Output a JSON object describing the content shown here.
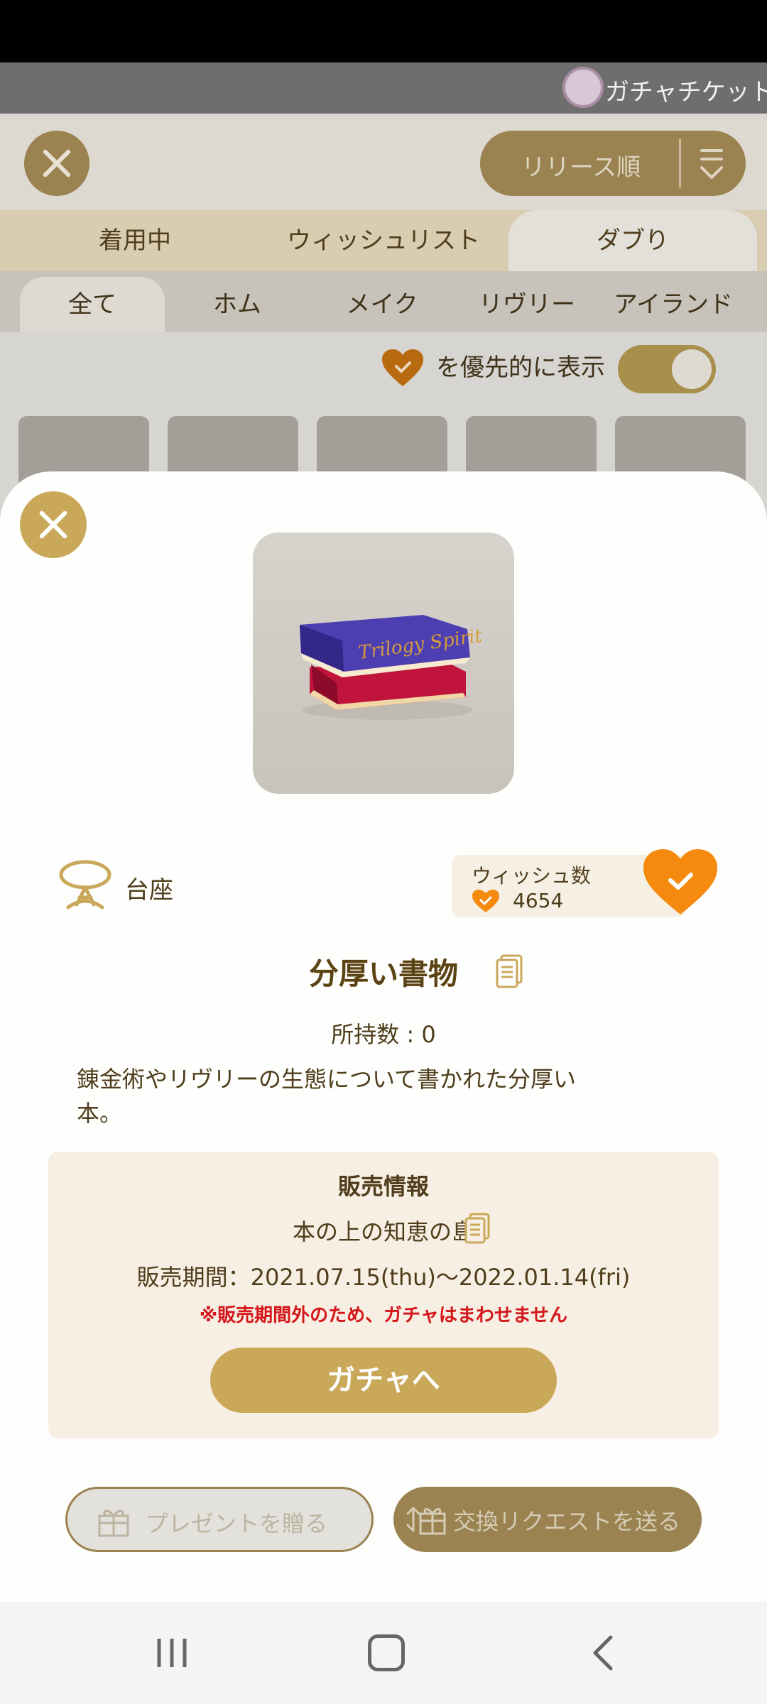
{
  "background": {
    "ticket_label": "ガチャチケット",
    "sort_label": "リリース順",
    "main_tabs": [
      {
        "label": "着用中",
        "active": false
      },
      {
        "label": "ウィッシュリスト",
        "active": false
      },
      {
        "label": "ダブり",
        "active": true
      }
    ],
    "sub_tabs": [
      {
        "label": "全て",
        "active": true
      },
      {
        "label": "ホム",
        "active": false
      },
      {
        "label": "メイク",
        "active": false
      },
      {
        "label": "リヴリー",
        "active": false
      },
      {
        "label": "アイランド",
        "active": false
      }
    ],
    "priority_label": "を優先的に表示",
    "priority_toggle_on": true
  },
  "item": {
    "image_text": "Trilogy Spirit",
    "category": "台座",
    "wish_title": "ウィッシュ数",
    "wish_count": "4654",
    "wish_active": true,
    "name": "分厚い書物",
    "owned": "所持数 : 0",
    "description_line1": "錬金術やリヴリーの生態について書かれた分厚い",
    "description_line2": "本。"
  },
  "sales": {
    "title": "販売情報",
    "event": "本の上の知恵の島",
    "period": "販売期間：2021.07.15(thu)〜2022.01.14(fri)",
    "warning": "※販売期間外のため、ガチャはまわせません",
    "gacha_button": "ガチャへ"
  },
  "actions": {
    "present": "プレゼントを贈る",
    "exchange": "交換リクエストを送る"
  },
  "colors": {
    "gold": "#c9a85a",
    "orange_heart": "#f58a0f",
    "warning_red": "#d5161a",
    "text_brown": "#5b4313"
  }
}
